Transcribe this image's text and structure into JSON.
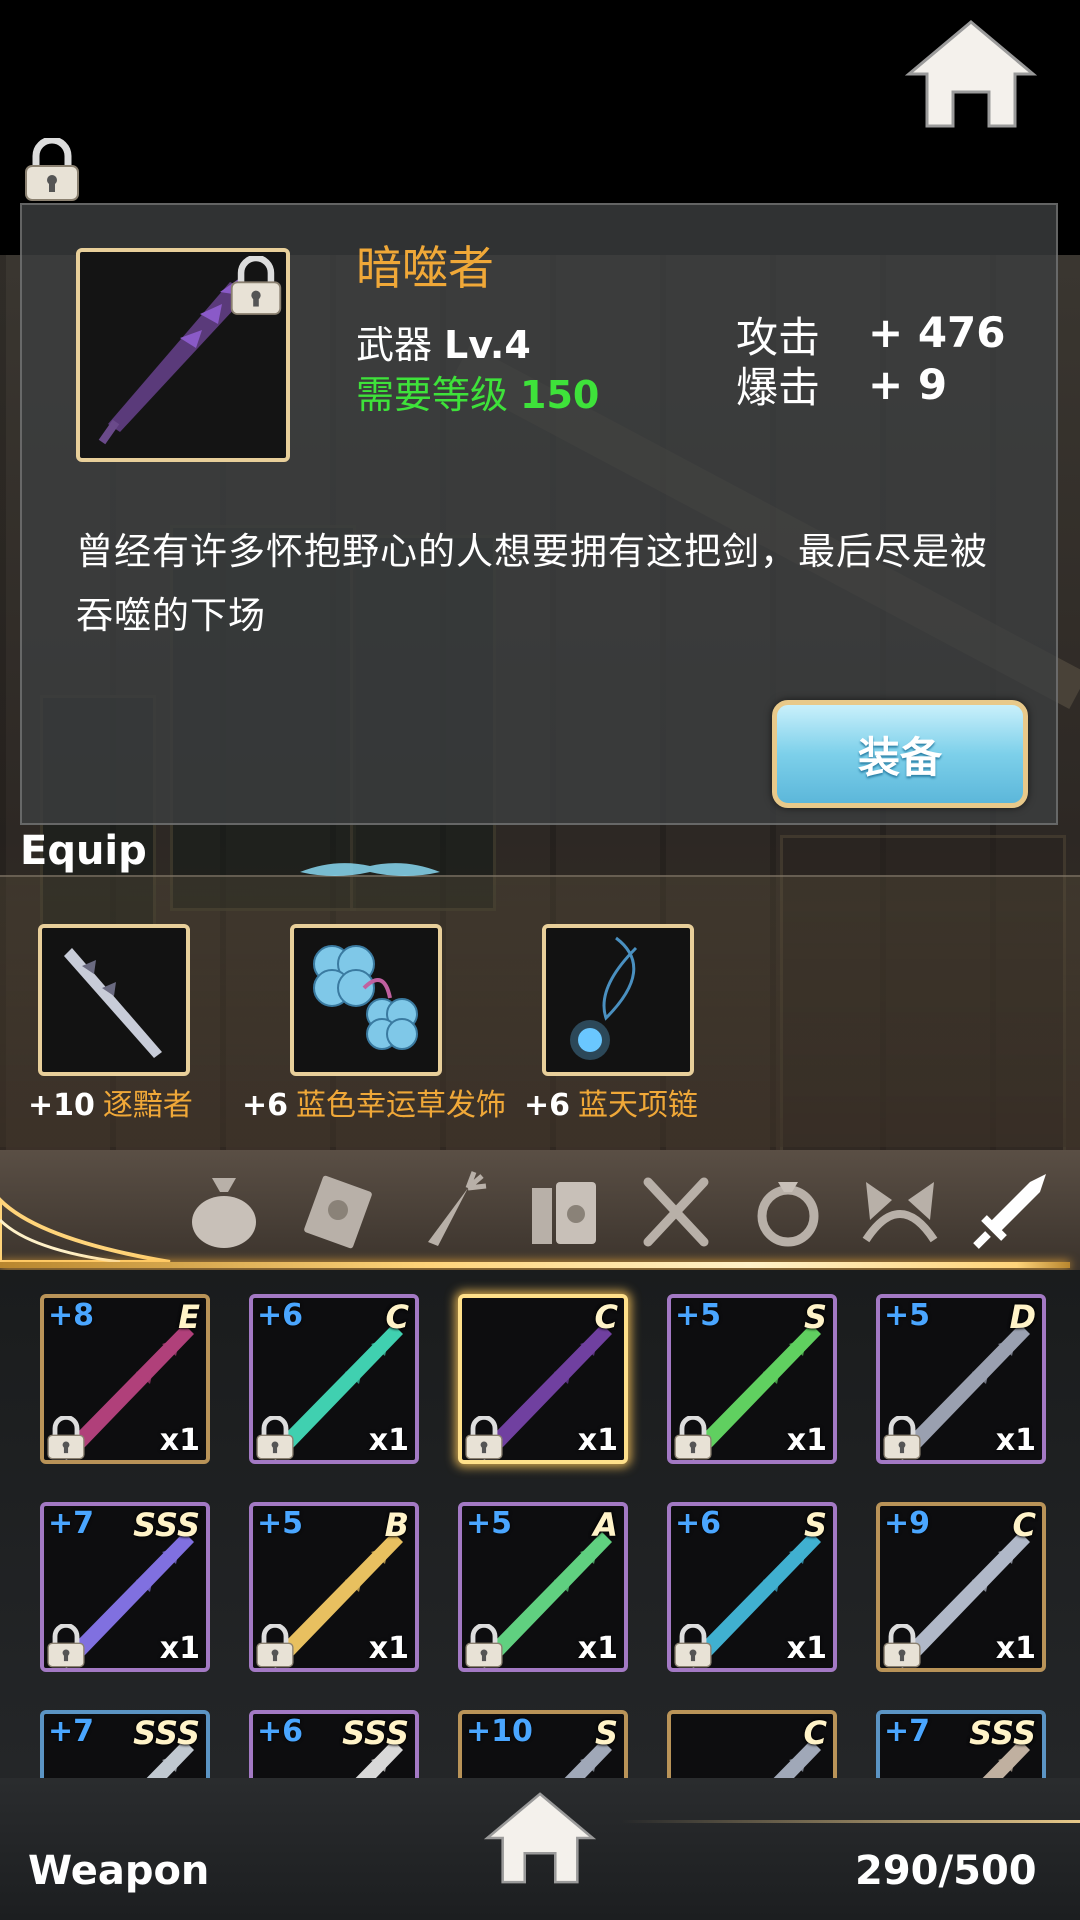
{
  "item": {
    "name": "暗噬者",
    "type_label": "武器",
    "level": "Lv.4",
    "requirement_label": "需要等级",
    "requirement_value": "150",
    "stats": [
      {
        "label": "攻击",
        "value": "+ 476"
      },
      {
        "label": "爆击",
        "value": "+ 9"
      }
    ],
    "description": "曾经有许多怀抱野心的人想要拥有这把剑，最后尽是被吞噬的下场"
  },
  "equip_button_label": "装备",
  "equip_section": {
    "title": "Equip",
    "slots": [
      {
        "plus": "+10",
        "name": "逐黯者"
      },
      {
        "plus": "+6",
        "name": "蓝色幸运草发饰"
      },
      {
        "plus": "+6",
        "name": "蓝天项链"
      }
    ]
  },
  "category_tabs": [
    "bag-icon",
    "letter-icon",
    "carrot-icon",
    "books-icon",
    "utensils-icon",
    "ring-icon",
    "cat-ears-icon",
    "sword-icon"
  ],
  "inventory": [
    {
      "plus": "+8",
      "rank": "E",
      "qty": "x1",
      "frame": "gold",
      "color": "#b0407a"
    },
    {
      "plus": "+6",
      "rank": "C",
      "qty": "x1",
      "frame": "purple",
      "color": "#40d0b0"
    },
    {
      "plus": "",
      "rank": "C",
      "qty": "x1",
      "frame": "selected",
      "color": "#7040a0"
    },
    {
      "plus": "+5",
      "rank": "S",
      "qty": "x1",
      "frame": "purple",
      "color": "#60d060"
    },
    {
      "plus": "+5",
      "rank": "D",
      "qty": "x1",
      "frame": "purple",
      "color": "#9aa0b0"
    },
    {
      "plus": "+7",
      "rank": "SSS",
      "qty": "x1",
      "frame": "purple",
      "color": "#8070e0"
    },
    {
      "plus": "+5",
      "rank": "B",
      "qty": "x1",
      "frame": "purple",
      "color": "#e8c060"
    },
    {
      "plus": "+5",
      "rank": "A",
      "qty": "x1",
      "frame": "purple",
      "color": "#60d080"
    },
    {
      "plus": "+6",
      "rank": "S",
      "qty": "x1",
      "frame": "purple",
      "color": "#40b0d0"
    },
    {
      "plus": "+9",
      "rank": "C",
      "qty": "x1",
      "frame": "gold",
      "color": "#b0b8c8"
    },
    {
      "plus": "+7",
      "rank": "SSS",
      "qty": "",
      "frame": "blue",
      "color": "#c0c8d0"
    },
    {
      "plus": "+6",
      "rank": "SSS",
      "qty": "",
      "frame": "purple",
      "color": "#d8d8d8"
    },
    {
      "plus": "+10",
      "rank": "S",
      "qty": "",
      "frame": "gold",
      "color": "#a0a8b8"
    },
    {
      "plus": "",
      "rank": "C",
      "qty": "",
      "frame": "gold",
      "color": "#a0a8b8"
    },
    {
      "plus": "+7",
      "rank": "SSS",
      "qty": "",
      "frame": "blue",
      "color": "#c0b0a0"
    }
  ],
  "footer": {
    "title": "Weapon",
    "count": "290/500"
  }
}
